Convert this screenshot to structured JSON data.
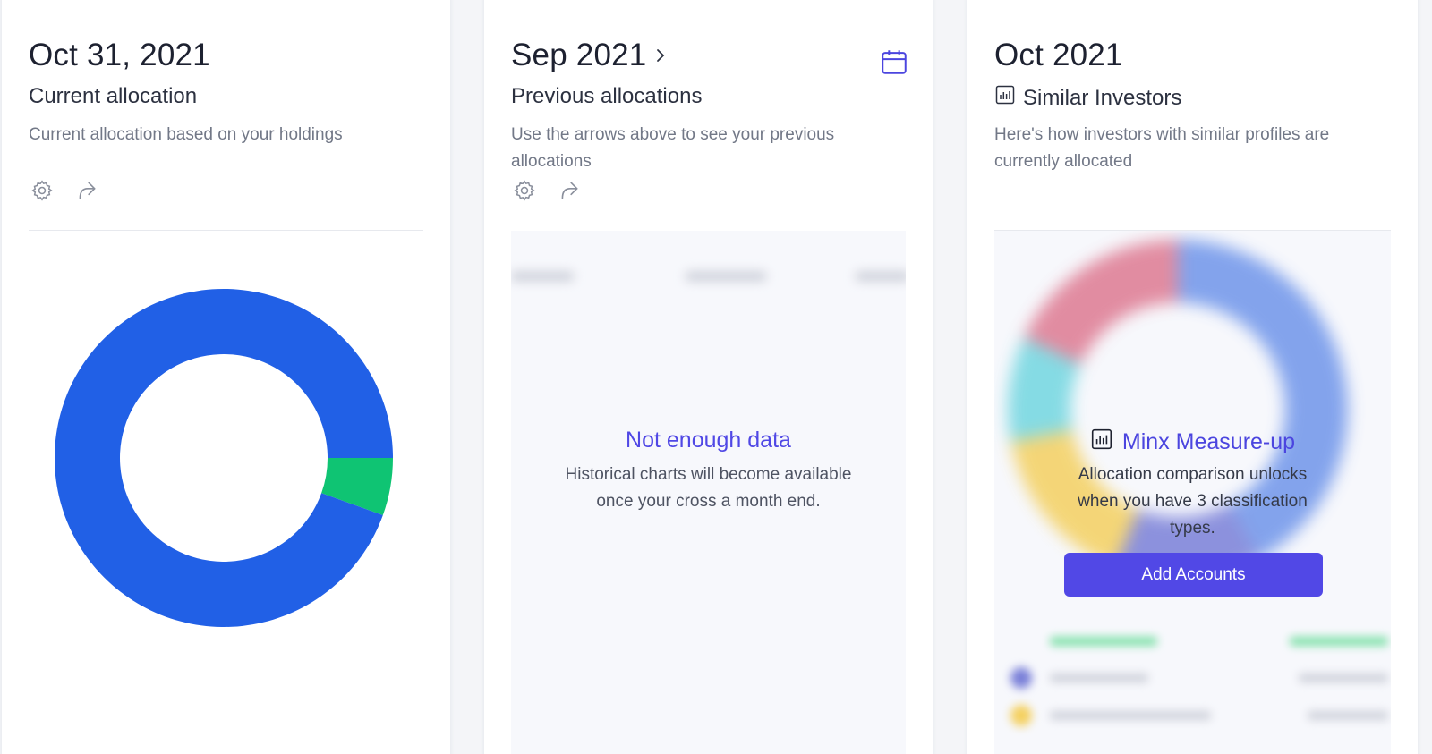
{
  "current": {
    "date": "Oct 31, 2021",
    "subtitle": "Current allocation",
    "description": "Current allocation based on your holdings",
    "icons": [
      "gear-icon",
      "share-icon"
    ],
    "donut": {
      "segments": [
        {
          "value": 0.945,
          "color": "#2160e6"
        },
        {
          "value": 0.055,
          "color": "#0fc473"
        }
      ]
    }
  },
  "previous": {
    "date": "Sep 2021",
    "subtitle": "Previous allocations",
    "description": "Use the arrows above to see your previous allocations",
    "icons": [
      "gear-icon",
      "share-icon",
      "chevron-right-icon",
      "calendar-icon"
    ],
    "empty_title": "Not enough data",
    "empty_text": "Historical charts will become available once your cross a month end."
  },
  "similar": {
    "date": "Oct 2021",
    "subtitle": "Similar Investors",
    "description": "Here's how investors with similar profiles are currently allocated",
    "icons": [
      "bar-chart-icon"
    ],
    "measure_title": "Minx Measure-up",
    "measure_text": "Allocation comparison unlocks when you have 3 classification types.",
    "add_button": "Add Accounts",
    "blurred_donut": {
      "segments": [
        {
          "value": 0.42,
          "color": "#6f95ea"
        },
        {
          "value": 0.14,
          "color": "#7a80d8"
        },
        {
          "value": 0.16,
          "color": "#f4d060"
        },
        {
          "value": 0.1,
          "color": "#72d6e0"
        },
        {
          "value": 0.18,
          "color": "#de7a92"
        }
      ]
    }
  },
  "colors": {
    "accent": "#5148e6",
    "primary_blue": "#2160e6",
    "green": "#0fc473"
  }
}
